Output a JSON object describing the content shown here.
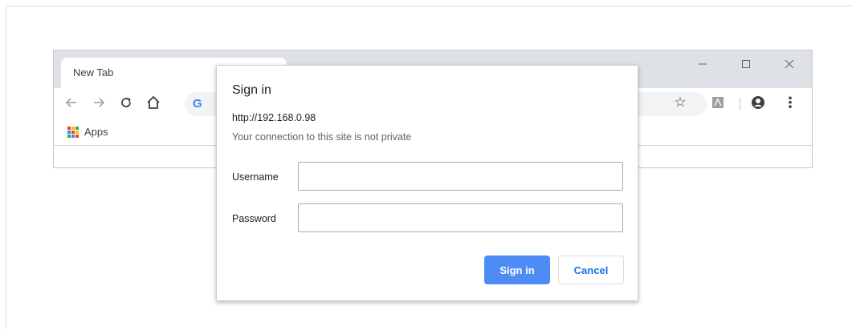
{
  "browser": {
    "tab_title": "New Tab",
    "window_controls": {
      "minimize": "—",
      "maximize": "☐",
      "close": "✕"
    },
    "toolbar": {
      "back_icon": "←",
      "forward_icon": "→",
      "reload_icon": "C",
      "home_icon": "⌂",
      "google_logo": "G",
      "star_icon": "☆",
      "menu_icon": "⋮"
    },
    "bookmarks": {
      "apps_label": "Apps",
      "apps_colors": [
        "#ea4335",
        "#fbbc05",
        "#34a853",
        "#4285f4",
        "#ea4335",
        "#fbbc05",
        "#34a853",
        "#4285f4",
        "#ea4335"
      ]
    }
  },
  "dialog": {
    "title": "Sign in",
    "url": "http://192.168.0.98",
    "warning": "Your connection to this site is not private",
    "username_label": "Username",
    "username_value": "",
    "password_label": "Password",
    "password_value": "",
    "sign_in_label": "Sign in",
    "cancel_label": "Cancel"
  },
  "colors": {
    "primary_button": "#4d8cf5",
    "cancel_text": "#1a73e8"
  }
}
